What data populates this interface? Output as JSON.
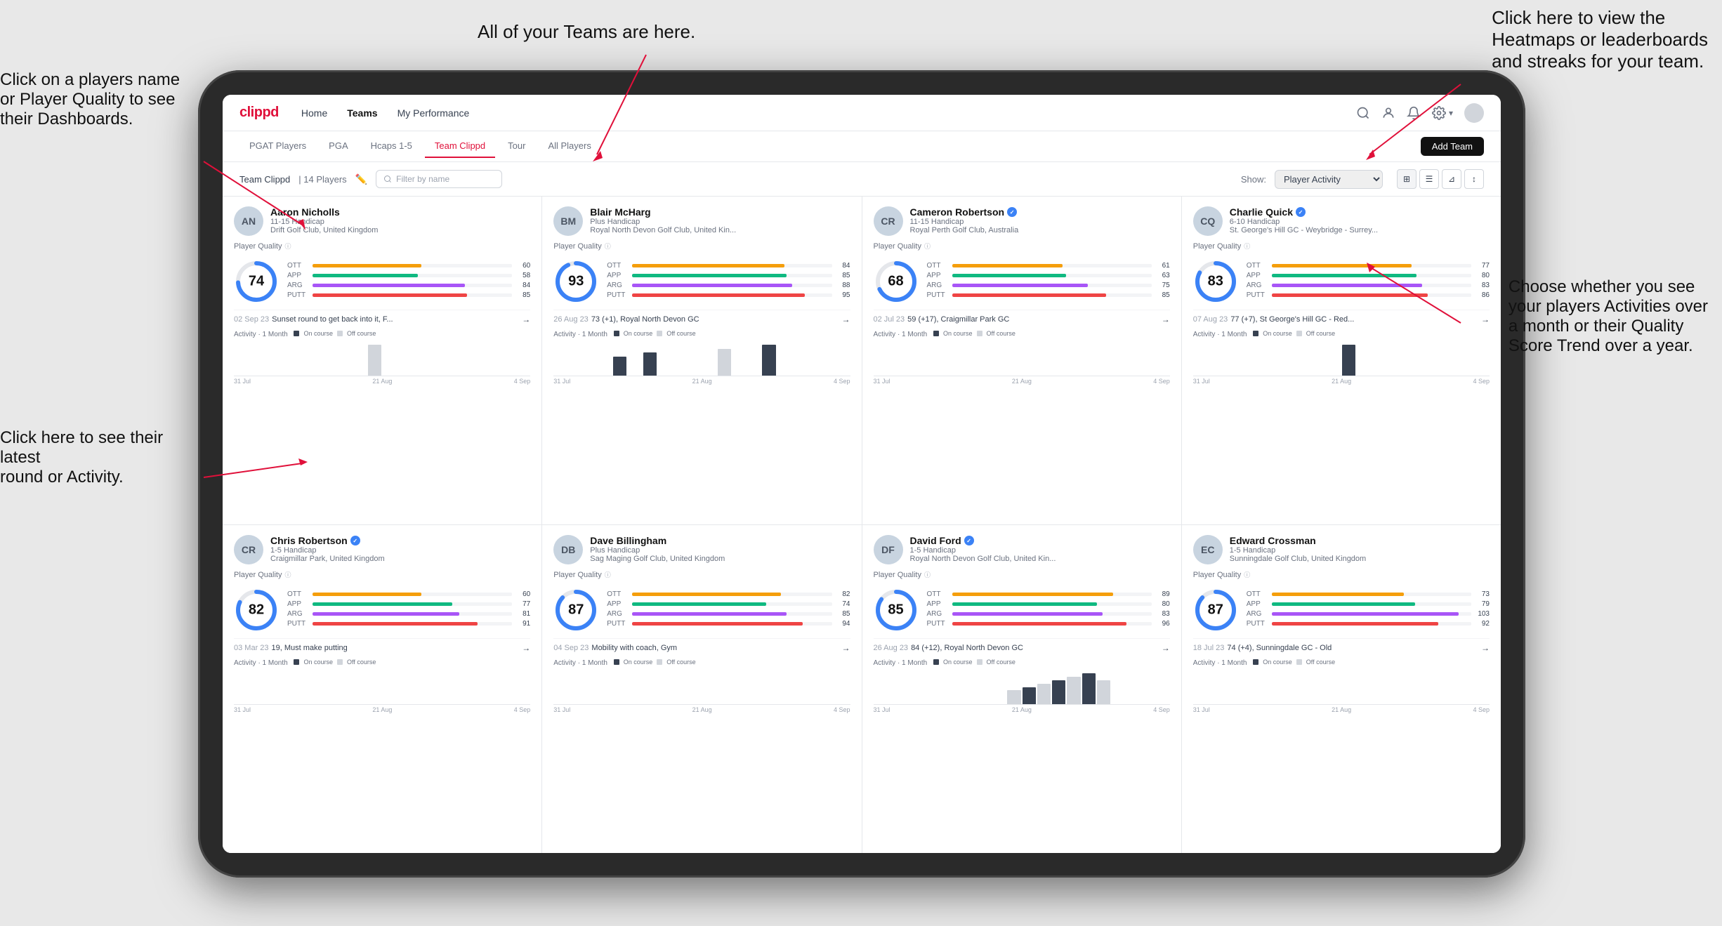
{
  "annotations": {
    "top_center": "All of your Teams are here.",
    "top_right_line1": "Click here to view the",
    "top_right_line2": "Heatmaps or leaderboards",
    "top_right_line3": "and streaks for your team.",
    "left_top_line1": "Click on a players name",
    "left_top_line2": "or Player Quality to see",
    "left_top_line3": "their Dashboards.",
    "left_bottom_line1": "Click here to see their latest",
    "left_bottom_line2": "round or Activity.",
    "bottom_right_line1": "Choose whether you see",
    "bottom_right_line2": "your players Activities over",
    "bottom_right_line3": "a month or their Quality",
    "bottom_right_line4": "Score Trend over a year."
  },
  "navbar": {
    "brand": "clippd",
    "links": [
      "Home",
      "Teams",
      "My Performance"
    ],
    "active_link": "Teams"
  },
  "subnav": {
    "tabs": [
      "PGAT Players",
      "PGA",
      "Hcaps 1-5",
      "Team Clippd",
      "Tour",
      "All Players"
    ],
    "active_tab": "Team Clippd",
    "add_team_label": "Add Team"
  },
  "toolbar": {
    "team_label": "Team Clippd",
    "player_count": "14 Players",
    "filter_placeholder": "Filter by name",
    "show_label": "Show:",
    "show_value": "Player Activity",
    "view_icons": [
      "grid-2",
      "grid-4",
      "filter",
      "sort"
    ]
  },
  "players": [
    {
      "name": "Aaron Nicholls",
      "handicap": "11-15 Handicap",
      "club": "Drift Golf Club, United Kingdom",
      "verified": false,
      "quality_score": 74,
      "quality_color": "#3b82f6",
      "stats": [
        {
          "label": "OTT",
          "value": 60,
          "color": "#f59e0b"
        },
        {
          "label": "APP",
          "value": 58,
          "color": "#10b981"
        },
        {
          "label": "ARG",
          "value": 84,
          "color": "#a855f7"
        },
        {
          "label": "PUTT",
          "value": 85,
          "color": "#ef4444"
        }
      ],
      "round_date": "02 Sep 23",
      "round_desc": "Sunset round to get back into it, F...",
      "activity_label": "Activity · 1 Month",
      "bars": [
        0,
        0,
        0,
        0,
        0,
        0,
        0,
        0,
        0,
        15,
        0,
        0,
        0,
        0,
        0,
        0,
        0,
        0,
        0,
        0
      ],
      "dates": [
        "31 Jul",
        "21 Aug",
        "4 Sep"
      ]
    },
    {
      "name": "Blair McHarg",
      "handicap": "Plus Handicap",
      "club": "Royal North Devon Golf Club, United Kin...",
      "verified": false,
      "quality_score": 93,
      "quality_color": "#3b82f6",
      "stats": [
        {
          "label": "OTT",
          "value": 84,
          "color": "#f59e0b"
        },
        {
          "label": "APP",
          "value": 85,
          "color": "#10b981"
        },
        {
          "label": "ARG",
          "value": 88,
          "color": "#a855f7"
        },
        {
          "label": "PUTT",
          "value": 95,
          "color": "#ef4444"
        }
      ],
      "round_date": "26 Aug 23",
      "round_desc": "73 (+1), Royal North Devon GC",
      "activity_label": "Activity · 1 Month",
      "bars": [
        0,
        0,
        0,
        0,
        25,
        0,
        30,
        0,
        0,
        0,
        0,
        35,
        0,
        0,
        40,
        0,
        0,
        0,
        0,
        0
      ],
      "dates": [
        "31 Jul",
        "21 Aug",
        "4 Sep"
      ]
    },
    {
      "name": "Cameron Robertson",
      "handicap": "11-15 Handicap",
      "club": "Royal Perth Golf Club, Australia",
      "verified": true,
      "quality_score": 68,
      "quality_color": "#3b82f6",
      "stats": [
        {
          "label": "OTT",
          "value": 61,
          "color": "#f59e0b"
        },
        {
          "label": "APP",
          "value": 63,
          "color": "#10b981"
        },
        {
          "label": "ARG",
          "value": 75,
          "color": "#a855f7"
        },
        {
          "label": "PUTT",
          "value": 85,
          "color": "#ef4444"
        }
      ],
      "round_date": "02 Jul 23",
      "round_desc": "59 (+17), Craigmillar Park GC",
      "activity_label": "Activity · 1 Month",
      "bars": [
        0,
        0,
        0,
        0,
        0,
        0,
        0,
        0,
        0,
        0,
        0,
        0,
        0,
        0,
        0,
        0,
        0,
        0,
        0,
        0
      ],
      "dates": [
        "31 Jul",
        "21 Aug",
        "4 Sep"
      ]
    },
    {
      "name": "Charlie Quick",
      "handicap": "6-10 Handicap",
      "club": "St. George's Hill GC - Weybridge - Surrey...",
      "verified": true,
      "quality_score": 83,
      "quality_color": "#3b82f6",
      "stats": [
        {
          "label": "OTT",
          "value": 77,
          "color": "#f59e0b"
        },
        {
          "label": "APP",
          "value": 80,
          "color": "#10b981"
        },
        {
          "label": "ARG",
          "value": 83,
          "color": "#a855f7"
        },
        {
          "label": "PUTT",
          "value": 86,
          "color": "#ef4444"
        }
      ],
      "round_date": "07 Aug 23",
      "round_desc": "77 (+7), St George's Hill GC - Red...",
      "activity_label": "Activity · 1 Month",
      "bars": [
        0,
        0,
        0,
        0,
        0,
        0,
        0,
        0,
        0,
        0,
        20,
        0,
        0,
        0,
        0,
        0,
        0,
        0,
        0,
        0
      ],
      "dates": [
        "31 Jul",
        "21 Aug",
        "4 Sep"
      ]
    },
    {
      "name": "Chris Robertson",
      "handicap": "1-5 Handicap",
      "club": "Craigmillar Park, United Kingdom",
      "verified": true,
      "quality_score": 82,
      "quality_color": "#3b82f6",
      "stats": [
        {
          "label": "OTT",
          "value": 60,
          "color": "#f59e0b"
        },
        {
          "label": "APP",
          "value": 77,
          "color": "#10b981"
        },
        {
          "label": "ARG",
          "value": 81,
          "color": "#a855f7"
        },
        {
          "label": "PUTT",
          "value": 91,
          "color": "#ef4444"
        }
      ],
      "round_date": "03 Mar 23",
      "round_desc": "19, Must make putting",
      "activity_label": "Activity · 1 Month",
      "bars": [
        0,
        0,
        0,
        0,
        0,
        0,
        0,
        0,
        0,
        0,
        0,
        0,
        0,
        0,
        0,
        0,
        0,
        0,
        0,
        0
      ],
      "dates": [
        "31 Jul",
        "21 Aug",
        "4 Sep"
      ]
    },
    {
      "name": "Dave Billingham",
      "handicap": "Plus Handicap",
      "club": "Sag Maging Golf Club, United Kingdom",
      "verified": false,
      "quality_score": 87,
      "quality_color": "#3b82f6",
      "stats": [
        {
          "label": "OTT",
          "value": 82,
          "color": "#f59e0b"
        },
        {
          "label": "APP",
          "value": 74,
          "color": "#10b981"
        },
        {
          "label": "ARG",
          "value": 85,
          "color": "#a855f7"
        },
        {
          "label": "PUTT",
          "value": 94,
          "color": "#ef4444"
        }
      ],
      "round_date": "04 Sep 23",
      "round_desc": "Mobility with coach, Gym",
      "activity_label": "Activity · 1 Month",
      "bars": [
        0,
        0,
        0,
        0,
        0,
        0,
        0,
        0,
        0,
        0,
        0,
        0,
        0,
        0,
        0,
        0,
        0,
        0,
        0,
        0
      ],
      "dates": [
        "31 Jul",
        "21 Aug",
        "4 Sep"
      ]
    },
    {
      "name": "David Ford",
      "handicap": "1-5 Handicap",
      "club": "Royal North Devon Golf Club, United Kin...",
      "verified": true,
      "quality_score": 85,
      "quality_color": "#3b82f6",
      "stats": [
        {
          "label": "OTT",
          "value": 89,
          "color": "#f59e0b"
        },
        {
          "label": "APP",
          "value": 80,
          "color": "#10b981"
        },
        {
          "label": "ARG",
          "value": 83,
          "color": "#a855f7"
        },
        {
          "label": "PUTT",
          "value": 96,
          "color": "#ef4444"
        }
      ],
      "round_date": "26 Aug 23",
      "round_desc": "84 (+12), Royal North Devon GC",
      "activity_label": "Activity · 1 Month",
      "bars": [
        0,
        0,
        0,
        0,
        0,
        0,
        0,
        0,
        0,
        20,
        25,
        30,
        35,
        40,
        45,
        35,
        0,
        0,
        0,
        0
      ],
      "dates": [
        "31 Jul",
        "21 Aug",
        "4 Sep"
      ]
    },
    {
      "name": "Edward Crossman",
      "handicap": "1-5 Handicap",
      "club": "Sunningdale Golf Club, United Kingdom",
      "verified": false,
      "quality_score": 87,
      "quality_color": "#3b82f6",
      "stats": [
        {
          "label": "OTT",
          "value": 73,
          "color": "#f59e0b"
        },
        {
          "label": "APP",
          "value": 79,
          "color": "#10b981"
        },
        {
          "label": "ARG",
          "value": 103,
          "color": "#a855f7"
        },
        {
          "label": "PUTT",
          "value": 92,
          "color": "#ef4444"
        }
      ],
      "round_date": "18 Jul 23",
      "round_desc": "74 (+4), Sunningdale GC - Old",
      "activity_label": "Activity · 1 Month",
      "bars": [
        0,
        0,
        0,
        0,
        0,
        0,
        0,
        0,
        0,
        0,
        0,
        0,
        0,
        0,
        0,
        0,
        0,
        0,
        0,
        0
      ],
      "dates": [
        "31 Jul",
        "21 Aug",
        "4 Sep"
      ]
    }
  ],
  "colors": {
    "brand": "#e0103a",
    "nav_bg": "#ffffff",
    "card_bg": "#ffffff",
    "grid_gap": "#e5e7eb",
    "ott": "#f59e0b",
    "app": "#10b981",
    "arg": "#a855f7",
    "putt": "#ef4444",
    "on_course": "#374151",
    "off_course": "#d1d5db"
  }
}
